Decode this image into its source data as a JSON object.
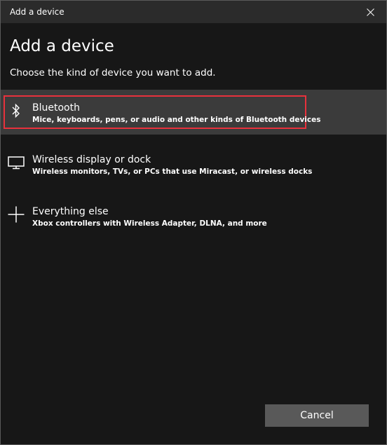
{
  "window": {
    "title": "Add a device"
  },
  "header": {
    "heading": "Add a device",
    "subheading": "Choose the kind of device you want to add."
  },
  "options": [
    {
      "icon": "bluetooth-icon",
      "title": "Bluetooth",
      "description": "Mice, keyboards, pens, or audio and other kinds of Bluetooth devices",
      "selected": true
    },
    {
      "icon": "monitor-icon",
      "title": "Wireless display or dock",
      "description": "Wireless monitors, TVs, or PCs that use Miracast, or wireless docks",
      "selected": false
    },
    {
      "icon": "plus-icon",
      "title": "Everything else",
      "description": "Xbox controllers with Wireless Adapter, DLNA, and more",
      "selected": false
    }
  ],
  "footer": {
    "cancel_label": "Cancel"
  },
  "colors": {
    "background": "#171717",
    "titlebar": "#2b2b2b",
    "selected_row": "#3b3b3b",
    "focus_outline": "#e8313c",
    "button": "#595959",
    "text": "#ffffff"
  }
}
